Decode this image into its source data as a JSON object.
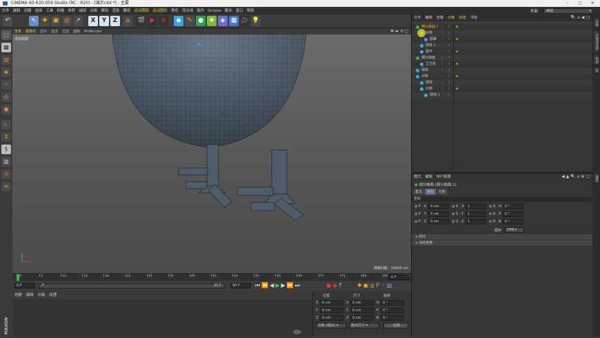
{
  "window": {
    "title": "CINEMA 4D R20.059 Studio (RC - R20) - [演示c4d *] - 主要"
  },
  "menubar": {
    "items": [
      "文件",
      "编辑",
      "创建",
      "选择",
      "工具",
      "网格",
      "体积",
      "捕捉",
      "动画",
      "模拟",
      "渲染",
      "雕刻",
      "运动跟踪",
      "运动图形",
      "角色",
      "流水线",
      "插件",
      "Octane",
      "脚本",
      "窗口",
      "帮助"
    ],
    "layout_label": "界面:",
    "layout_value": "启动"
  },
  "toolbar": {
    "axis_x": "X",
    "axis_y": "Y",
    "axis_z": "Z"
  },
  "viewport": {
    "menu": [
      "查看",
      "摄像机",
      "显示",
      "选项",
      "过滤",
      "面板",
      "ProRender"
    ],
    "camera_label": "透视视图",
    "grid_info": "网格间距 : 10000 cm"
  },
  "timeline": {
    "ticks": [
      "0",
      "5",
      "10",
      "15",
      "20",
      "25",
      "30",
      "35",
      "40",
      "45",
      "50",
      "55",
      "60",
      "65",
      "70",
      "75",
      "80",
      "85",
      "90"
    ],
    "current_frame": "0 F",
    "start_field": "0 F",
    "end_field": "90 F",
    "range_right": "90 F",
    "range_left": "F"
  },
  "materials": {
    "menu": [
      "创建",
      "编辑",
      "功能",
      "纹理"
    ]
  },
  "coordinates": {
    "headers": [
      "位置",
      "尺寸",
      "旋转"
    ],
    "rows": [
      {
        "pl": "X",
        "pv": "0 cm",
        "sl": "X",
        "sv": "0 cm",
        "rl": "H",
        "rv": "0 °"
      },
      {
        "pl": "Y",
        "pv": "0 cm",
        "sl": "Y",
        "sv": "0 cm",
        "rl": "P",
        "rv": "0 °"
      },
      {
        "pl": "Z",
        "pv": "0 cm",
        "sl": "Z",
        "sv": "0 cm",
        "rl": "B",
        "rv": "0 °"
      }
    ],
    "mode_left": "对象 (相对)",
    "mode_mid": "绝对尺寸",
    "apply": "应用"
  },
  "object_manager": {
    "tabs": [
      "文件",
      "编辑",
      "查看",
      "对象",
      "标签",
      "书签"
    ],
    "objects": [
      {
        "name": "细分曲面.1",
        "indent": 0,
        "icon": "#3bb34a",
        "selected": true
      },
      {
        "name": "对称",
        "indent": 1,
        "icon": "#3bb0e0",
        "selected": false
      },
      {
        "name": "圆锥",
        "indent": 2,
        "icon": "#5aa0e8",
        "selected": false
      },
      {
        "name": "球体.1",
        "indent": 1,
        "icon": "#3bb0e0",
        "selected": false
      },
      {
        "name": "圆环",
        "indent": 1,
        "icon": "#3bb0e0",
        "selected": false
      },
      {
        "name": "细分曲面",
        "indent": 0,
        "icon": "#3bb34a",
        "selected": false
      },
      {
        "name": "立方体",
        "indent": 1,
        "icon": "#5aa0e8",
        "selected": false
      },
      {
        "name": "球体",
        "indent": 0,
        "icon": "#3bb0e0",
        "selected": false
      },
      {
        "name": "对称",
        "indent": 0,
        "icon": "#3bb0e0",
        "selected": false
      },
      {
        "name": "球体",
        "indent": 1,
        "icon": "#3bb0e0",
        "selected": false
      },
      {
        "name": "对称",
        "indent": 1,
        "icon": "#3bb0e0",
        "selected": false
      },
      {
        "name": "球体.1",
        "indent": 2,
        "icon": "#3bb0e0",
        "selected": false
      }
    ]
  },
  "attribute_manager": {
    "menu": [
      "模式",
      "编辑",
      "用户数据"
    ],
    "object_title": "细分曲面 [细分曲面.1]",
    "tabs": [
      "基本",
      "坐标",
      "对象"
    ],
    "section": "坐标",
    "rows": [
      {
        "a": "P . X",
        "av": "0 cm",
        "b": "S . X",
        "bv": "1",
        "c": "R . H",
        "cv": "0 °"
      },
      {
        "a": "P . Y",
        "av": "0 cm",
        "b": "S . Y",
        "bv": "1",
        "c": "R . P",
        "cv": "0 °"
      },
      {
        "a": "P . Z",
        "av": "0 cm",
        "b": "S . Z",
        "bv": "1",
        "c": "R . B",
        "cv": "0 °"
      }
    ],
    "order_label": "顺序",
    "order_value": "HPB",
    "quaternion": "四元",
    "freeze": "冻结变换"
  },
  "right_strip": {
    "tabs": [
      "对象",
      "内容浏览器",
      "构造",
      "层"
    ],
    "attr_tab": "属性"
  },
  "watermark": "Ch"
}
